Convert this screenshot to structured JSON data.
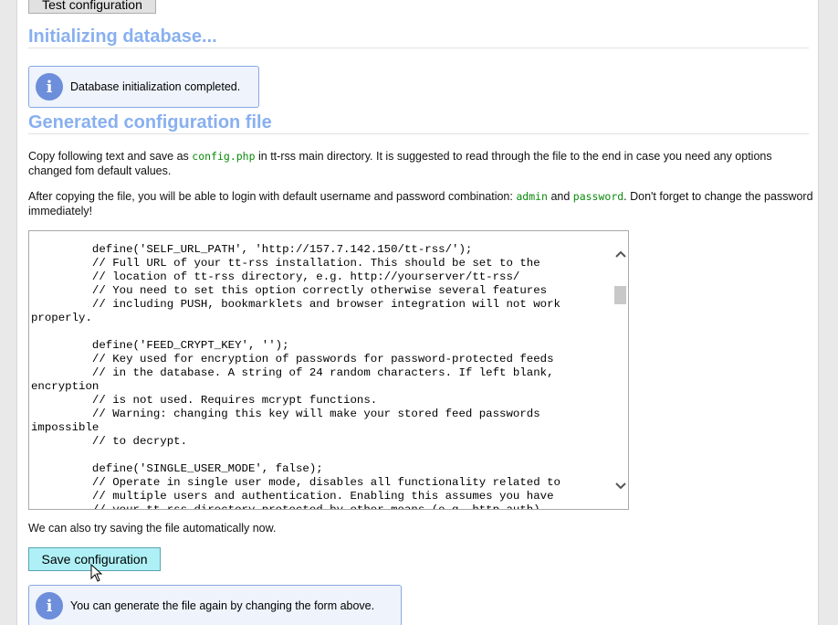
{
  "buttons": {
    "test_configuration": "Test configuration",
    "save_configuration": "Save configuration"
  },
  "sections": {
    "initializing": "Initializing database...",
    "generated": "Generated configuration file"
  },
  "notices": {
    "db_completed": "Database initialization completed.",
    "generate_again": "You can generate the file again by changing the form above."
  },
  "paragraphs": {
    "copy_text_pre": "Copy following text and save as ",
    "copy_text_code": "config.php",
    "copy_text_post": " in tt-rss main directory. It is suggested to read through the file to the end in case you need any options changed fom default values.",
    "login_pre": "After copying the file, you will be able to login with default username and password combination: ",
    "login_user": "admin",
    "login_and": " and ",
    "login_pass": "password",
    "login_post": ". Don't forget to change the password immediately!",
    "save_auto": "We can also try saving the file automatically now."
  },
  "config_text": "\tdefine('SELF_URL_PATH', 'http://157.7.142.150/tt-rss/');\n\t// Full URL of your tt-rss installation. This should be set to the\n\t// location of tt-rss directory, e.g. http://yourserver/tt-rss/\n\t// You need to set this option correctly otherwise several features\n\t// including PUSH, bookmarklets and browser integration will not work\nproperly.\n\n\tdefine('FEED_CRYPT_KEY', '');\n\t// Key used for encryption of passwords for password-protected feeds\n\t// in the database. A string of 24 random characters. If left blank,\nencryption\n\t// is not used. Requires mcrypt functions.\n\t// Warning: changing this key will make your stored feed passwords\nimpossible\n\t// to decrypt.\n\n\tdefine('SINGLE_USER_MODE', false);\n\t// Operate in single user mode, disables all functionality related to\n\t// multiple users and authentication. Enabling this assumes you have\n\t// your tt-rss directory protected by other means (e.g. http auth).",
  "icons": {
    "info": "info-icon",
    "scroll_up": "chevron-up-icon",
    "scroll_down": "chevron-down-icon",
    "cursor": "mouse-pointer-icon"
  },
  "colors": {
    "heading": "#88b0f0",
    "notice_bg": "#eef3fc",
    "notice_border": "#88a8e0",
    "info_icon": "#6c8edb",
    "save_button_bg": "#aef0f6",
    "code_green": "#0a8a0a"
  }
}
